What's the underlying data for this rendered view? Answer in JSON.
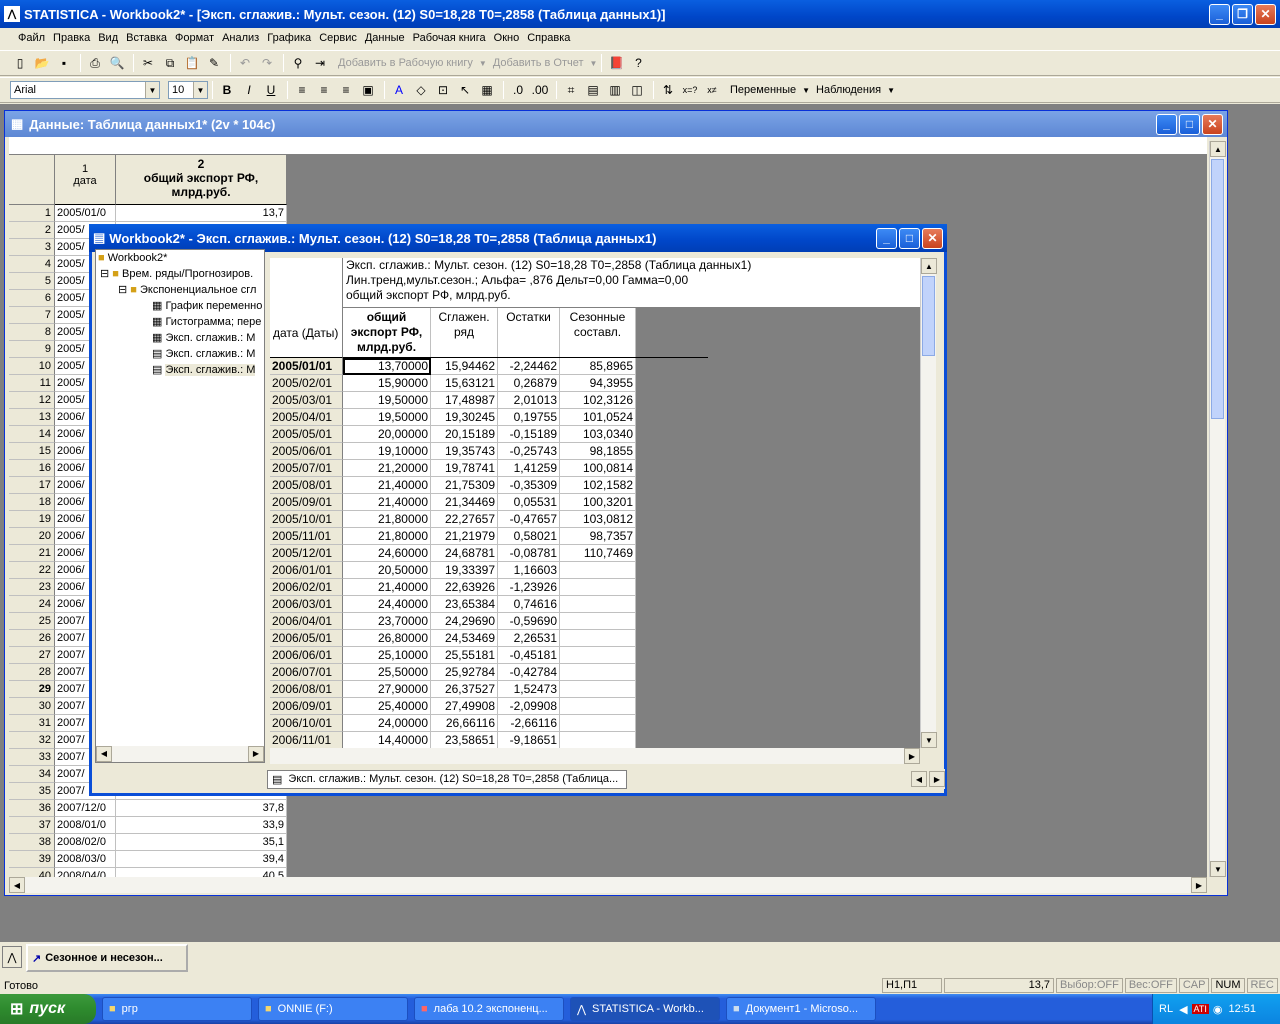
{
  "app": {
    "title": "STATISTICA - Workbook2* - [Эксп. сглажив.: Мульт. сезон. (12) S0=18,28 T0=,2858 (Таблица данных1)]"
  },
  "menu": [
    "Файл",
    "Правка",
    "Вид",
    "Вставка",
    "Формат",
    "Анализ",
    "Графика",
    "Сервис",
    "Данные",
    "Рабочая книга",
    "Окно",
    "Справка"
  ],
  "toolbar1": {
    "add_workbook": "Добавить в Рабочую книгу",
    "add_report": "Добавить в Отчет"
  },
  "toolbar2": {
    "font": "Arial",
    "size": "10",
    "vars": "Переменные",
    "cases": "Наблюдения"
  },
  "datawin": {
    "title": "Данные: Таблица данных1* (2v * 104c)",
    "col1_num": "1",
    "col1_name": "дата",
    "col2_num": "2",
    "col2_name": "общий экспорт РФ, млрд.руб.",
    "rows": [
      [
        "1",
        "2005/01/0",
        "13,7"
      ],
      [
        "2",
        "2005/",
        ""
      ],
      [
        "3",
        "2005/",
        ""
      ],
      [
        "4",
        "2005/",
        ""
      ],
      [
        "5",
        "2005/",
        ""
      ],
      [
        "6",
        "2005/",
        ""
      ],
      [
        "7",
        "2005/",
        ""
      ],
      [
        "8",
        "2005/",
        ""
      ],
      [
        "9",
        "2005/",
        ""
      ],
      [
        "10",
        "2005/",
        ""
      ],
      [
        "11",
        "2005/",
        ""
      ],
      [
        "12",
        "2005/",
        ""
      ],
      [
        "13",
        "2006/",
        ""
      ],
      [
        "14",
        "2006/",
        ""
      ],
      [
        "15",
        "2006/",
        ""
      ],
      [
        "16",
        "2006/",
        ""
      ],
      [
        "17",
        "2006/",
        ""
      ],
      [
        "18",
        "2006/",
        ""
      ],
      [
        "19",
        "2006/",
        ""
      ],
      [
        "20",
        "2006/",
        ""
      ],
      [
        "21",
        "2006/",
        ""
      ],
      [
        "22",
        "2006/",
        ""
      ],
      [
        "23",
        "2006/",
        ""
      ],
      [
        "24",
        "2006/",
        ""
      ],
      [
        "25",
        "2007/",
        ""
      ],
      [
        "26",
        "2007/",
        ""
      ],
      [
        "27",
        "2007/",
        ""
      ],
      [
        "28",
        "2007/",
        ""
      ],
      [
        "29",
        "2007/",
        ""
      ],
      [
        "30",
        "2007/",
        ""
      ],
      [
        "31",
        "2007/",
        ""
      ],
      [
        "32",
        "2007/",
        ""
      ],
      [
        "33",
        "2007/",
        ""
      ],
      [
        "34",
        "2007/",
        ""
      ],
      [
        "35",
        "2007/",
        ""
      ],
      [
        "36",
        "2007/12/0",
        "37,8"
      ],
      [
        "37",
        "2008/01/0",
        "33,9"
      ],
      [
        "38",
        "2008/02/0",
        "35,1"
      ],
      [
        "39",
        "2008/03/0",
        "39,4"
      ],
      [
        "40",
        "2008/04/0",
        "40,5"
      ]
    ]
  },
  "workbook": {
    "title": "Workbook2* - Эксп. сглажив.: Мульт. сезон. (12) S0=18,28 T0=,2858 (Таблица данных1)",
    "tree": [
      "Workbook2*",
      "Врем. ряды/Прогнозиров.",
      "Экспоненциальное сгл",
      "График переменно",
      "Гистограмма; пере",
      "Эксп. сглажив.: М",
      "Эксп. сглажив.: М",
      "Эксп. сглажив.: М"
    ],
    "header_lines": [
      "Эксп. сглажив.: Мульт. сезон. (12) S0=18,28 T0=,2858 (Таблица данных1)",
      "Лин.тренд,мульт.сезон.; Альфа= ,876 Дельт=0,00 Гамма=0,00",
      "общий экспорт РФ, млрд.руб."
    ],
    "rowhead": "дата (Даты)",
    "cols": [
      "общий экспорт РФ, млрд.руб.",
      "Сглажен. ряд",
      "Остатки",
      "Сезонные составл."
    ],
    "rows": [
      [
        "2005/01/01",
        "13,70000",
        "15,94462",
        "-2,24462",
        "85,8965"
      ],
      [
        "2005/02/01",
        "15,90000",
        "15,63121",
        "0,26879",
        "94,3955"
      ],
      [
        "2005/03/01",
        "19,50000",
        "17,48987",
        "2,01013",
        "102,3126"
      ],
      [
        "2005/04/01",
        "19,50000",
        "19,30245",
        "0,19755",
        "101,0524"
      ],
      [
        "2005/05/01",
        "20,00000",
        "20,15189",
        "-0,15189",
        "103,0340"
      ],
      [
        "2005/06/01",
        "19,10000",
        "19,35743",
        "-0,25743",
        "98,1855"
      ],
      [
        "2005/07/01",
        "21,20000",
        "19,78741",
        "1,41259",
        "100,0814"
      ],
      [
        "2005/08/01",
        "21,40000",
        "21,75309",
        "-0,35309",
        "102,1582"
      ],
      [
        "2005/09/01",
        "21,40000",
        "21,34469",
        "0,05531",
        "100,3201"
      ],
      [
        "2005/10/01",
        "21,80000",
        "22,27657",
        "-0,47657",
        "103,0812"
      ],
      [
        "2005/11/01",
        "21,80000",
        "21,21979",
        "0,58021",
        "98,7357"
      ],
      [
        "2005/12/01",
        "24,60000",
        "24,68781",
        "-0,08781",
        "110,7469"
      ],
      [
        "2006/01/01",
        "20,50000",
        "19,33397",
        "1,16603",
        ""
      ],
      [
        "2006/02/01",
        "21,40000",
        "22,63926",
        "-1,23926",
        ""
      ],
      [
        "2006/03/01",
        "24,40000",
        "23,65384",
        "0,74616",
        ""
      ],
      [
        "2006/04/01",
        "23,70000",
        "24,29690",
        "-0,59690",
        ""
      ],
      [
        "2006/05/01",
        "26,80000",
        "24,53469",
        "2,26531",
        ""
      ],
      [
        "2006/06/01",
        "25,10000",
        "25,55181",
        "-0,45181",
        ""
      ],
      [
        "2006/07/01",
        "25,50000",
        "25,92784",
        "-0,42784",
        ""
      ],
      [
        "2006/08/01",
        "27,90000",
        "26,37527",
        "1,52473",
        ""
      ],
      [
        "2006/09/01",
        "25,40000",
        "27,49908",
        "-2,09908",
        ""
      ],
      [
        "2006/10/01",
        "24,00000",
        "26,66116",
        "-2,66116",
        ""
      ],
      [
        "2006/11/01",
        "14,40000",
        "23,58651",
        "-9,18651",
        ""
      ]
    ],
    "tab": "Эксп. сглажив.: Мульт. сезон. (12) S0=18,28 T0=,2858 (Таблица..."
  },
  "minimized": "Сезонное и несезон...",
  "status": {
    "ready": "Готово",
    "pos": "Н1,П1",
    "val": "13,7",
    "sel": "Выбор:OFF",
    "wgt": "Вес:OFF",
    "cap": "CAP",
    "num": "NUM",
    "rec": "REC"
  },
  "taskbar": {
    "start": "пуск",
    "items": [
      "ргр",
      "ONNIE (F:)",
      "лаба 10.2 экспоненц...",
      "STATISTICA - Workb...",
      "Документ1 - Microso..."
    ],
    "lang": "RL",
    "clock": "12:51"
  }
}
